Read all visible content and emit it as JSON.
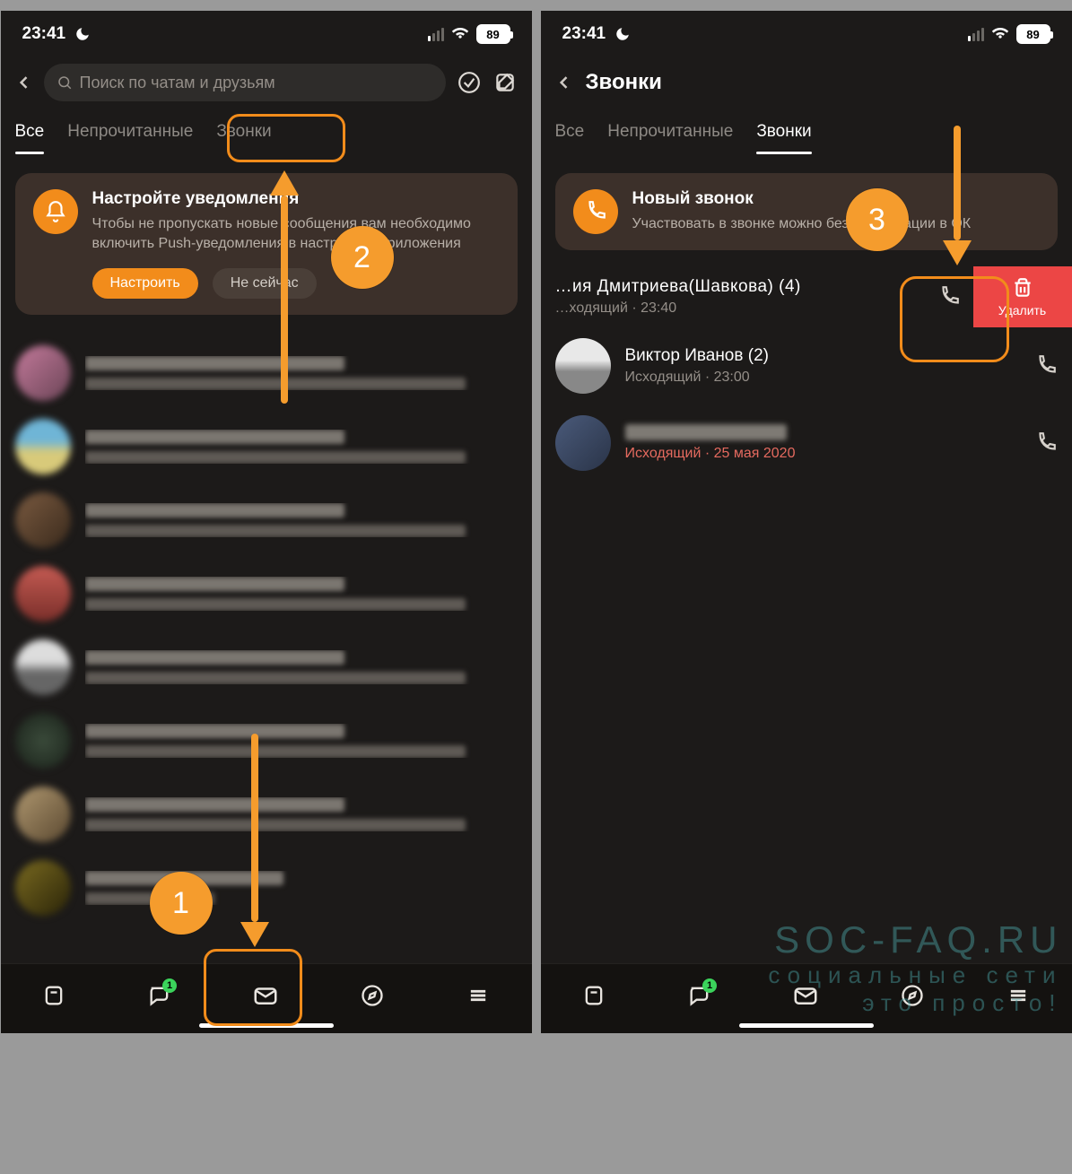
{
  "statusbar": {
    "time": "23:41",
    "battery": "89"
  },
  "left": {
    "search_placeholder": "Поиск по чатам и друзьям",
    "tabs": {
      "all": "Все",
      "unread": "Непрочитанные",
      "calls": "Звонки"
    },
    "card": {
      "title": "Настройте уведомления",
      "body": "Чтобы не пропускать новые сообщения вам необходимо включить Push-уведомления в настройках приложения",
      "primary": "Настроить",
      "secondary": "Не сейчас"
    }
  },
  "right": {
    "title": "Звонки",
    "tabs": {
      "all": "Все",
      "unread": "Непрочитанные",
      "calls": "Звонки"
    },
    "card": {
      "title": "Новый звонок",
      "body": "Участвовать в звонке можно без регистрации в ОК"
    },
    "swipe": {
      "name": "…ия Дмитриева(Шавкова) (4)",
      "sub": "…ходящий · 23:40",
      "delete": "Удалить"
    },
    "calls": [
      {
        "name": "Виктор Иванов (2)",
        "sub": "Исходящий · 23:00",
        "missed": false
      },
      {
        "name": "",
        "sub": "Исходящий · 25 мая 2020",
        "missed": true
      }
    ]
  },
  "nav": {
    "badge": "1"
  },
  "annotations": {
    "step1": "1",
    "step2": "2",
    "step3": "3"
  },
  "watermark": {
    "l1": "SOC-FAQ.RU",
    "l2": "социальные сети",
    "l3": "это просто!"
  }
}
